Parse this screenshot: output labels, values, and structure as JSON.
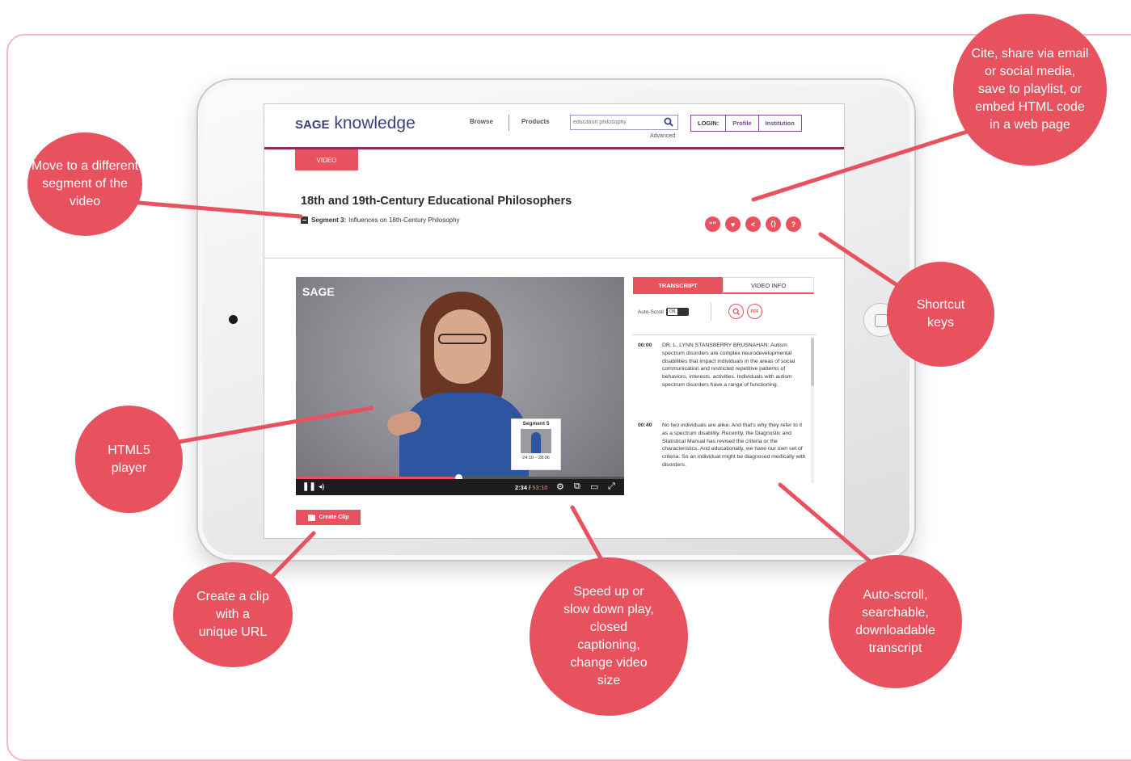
{
  "site": {
    "logo_brand": "SAGE",
    "logo_suffix": "knowledge",
    "nav_browse": "Browse",
    "nav_products": "Products",
    "search_placeholder": "education philosophy",
    "advanced": "Advanced",
    "login": "LOGIN:",
    "profile": "Profile",
    "institution": "Institution"
  },
  "page": {
    "type_tab": "VIDEO",
    "title": "18th and 19th-Century Educational Philosophers",
    "segment_label": "Segment 3:",
    "segment_title": "Influences on 18th-Century Philosophy",
    "action_icons": [
      {
        "icon": "cite-icon",
        "glyph": "“”"
      },
      {
        "icon": "heart-icon",
        "glyph": "♥"
      },
      {
        "icon": "share-icon",
        "glyph": "<"
      },
      {
        "icon": "embed-icon",
        "glyph": "⟨⟩"
      },
      {
        "icon": "help-icon",
        "glyph": "?"
      }
    ]
  },
  "player": {
    "watermark": "SAGE",
    "preview_title": "Segment 5",
    "preview_range": "24:10 – 28:06",
    "time_current": "2:34",
    "time_total": "53:10",
    "progress_fraction": 0.5,
    "create_clip": "Create Clip"
  },
  "transcript": {
    "tab_transcript": "TRANSCRIPT",
    "tab_info": "VIDEO INFO",
    "auto_scroll": "Auto-Scroll",
    "pdf": "PDF",
    "entries": [
      {
        "time": "00:00",
        "text": "DR. L. LYNN STANSBERRY BRUSNAHAN: Autism spectrum disorders are complex neurodevelopmental disabilities that impact individuals in the areas of social communication and restricted repetitive patterns of behaviors, interests, activities. Individuals with autism spectrum disorders have a range of functioning."
      },
      {
        "time": "00:40",
        "text": "No two individuals are alike. And that's why they refer to it as a spectrum disability. Recently, the Diagnostic and Statistical Manual has revised the criteria or the characteristics. And educationally, we have our own set of criteria. So an individual might be diagnosed medically with disorders."
      }
    ]
  },
  "callouts": {
    "segment": "Move to a different segment of the video",
    "cite": "Cite, share via email or social media, save to playlist, or embed HTML code in a web page",
    "shortcut": "Shortcut keys",
    "player": "HTML5 player",
    "clip": "Create a clip with a unique URL",
    "speed": "Speed up or slow down play, closed captioning, change video size",
    "transcript": "Auto-scroll, searchable, downloadable transcript"
  },
  "colors": {
    "accent": "#e8525f",
    "brand": "#3b3f7e",
    "rule": "#8c2c5c"
  }
}
